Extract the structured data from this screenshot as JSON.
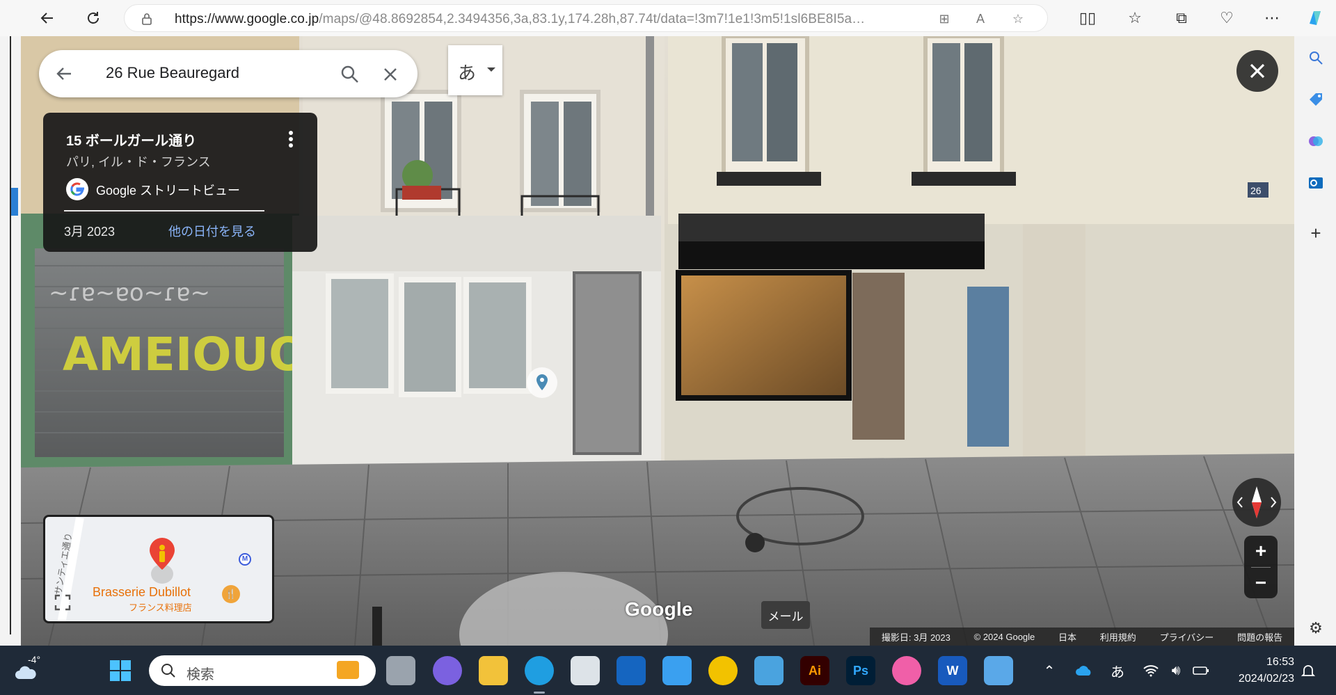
{
  "browser": {
    "url_host": "https://www.google.co.jp",
    "url_path": "/maps/@48.8692854,2.3494356,3a,83.1y,174.28h,87.74t/data=!3m7!1e1!3m5!1sl6BE8I5acK..."
  },
  "maps": {
    "search_value": "26 Rue Beauregard",
    "ime_char": "あ",
    "info_card": {
      "title": "15 ボールガール通り",
      "subtitle": "パリ, イル・ド・フランス",
      "source": "Google ストリートビュー",
      "date": "3月 2023",
      "other_dates": "他の日付を見る"
    },
    "minimap": {
      "street_label": "サンティエ通り",
      "place_name": "Brasserie Dubillot",
      "place_type": "フランス料理店",
      "metro": "M"
    },
    "wordmark": "Google",
    "tooltip": "メール",
    "footer": {
      "capture": "撮影日: 3月 2023",
      "copyright": "© 2024 Google",
      "country": "日本",
      "terms": "利用規約",
      "privacy": "プライバシー",
      "report": "問題の報告"
    },
    "scene": {
      "house_number": "26"
    }
  },
  "taskbar": {
    "weather": "-4°",
    "search_placeholder": "検索",
    "ime": "あ",
    "time": "16:53",
    "date": "2024/02/23",
    "apps": [
      "Ai",
      "Ps"
    ]
  }
}
